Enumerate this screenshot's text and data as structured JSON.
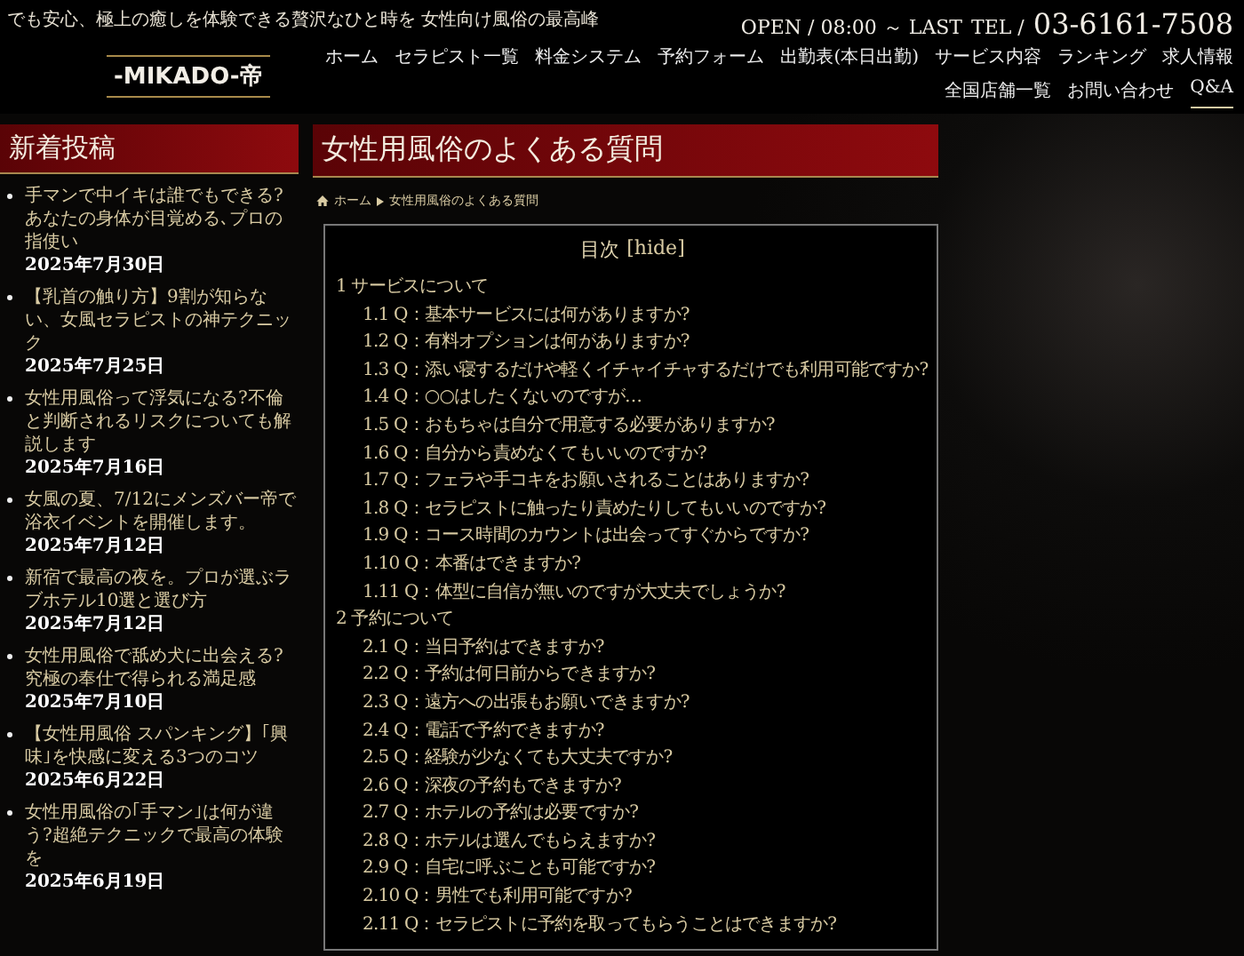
{
  "header": {
    "tagline": "でも安心、極上の癒しを体験できる贅沢なひと時を 女性向け風俗の最高峰",
    "logo": "-MIKADO-帝",
    "hours": "OPEN / 08:00 ～ LAST",
    "tel_label": "TEL /",
    "tel": "03-6161-7508"
  },
  "nav": [
    {
      "label": "ホーム",
      "selected": false
    },
    {
      "label": "セラピスト一覧",
      "selected": false
    },
    {
      "label": "料金システム",
      "selected": false
    },
    {
      "label": "予約フォーム",
      "selected": false
    },
    {
      "label": "出勤表(本日出勤)",
      "selected": false
    },
    {
      "label": "サービス内容",
      "selected": false
    },
    {
      "label": "ランキング",
      "selected": false
    },
    {
      "label": "求人情報",
      "selected": false
    },
    {
      "label": "全国店舗一覧",
      "selected": false
    },
    {
      "label": "お問い合わせ",
      "selected": false
    },
    {
      "label": "Q&A",
      "selected": true
    }
  ],
  "sidebar": {
    "title": "新着投稿",
    "posts": [
      {
        "title": "手マンで中イキは誰でもできる?あなたの身体が目覚める､プロの指使い",
        "date": "2025年7月30日"
      },
      {
        "title": "【乳首の触り方】9割が知らない、女風セラピストの神テクニック",
        "date": "2025年7月25日"
      },
      {
        "title": "女性用風俗って浮気になる?不倫と判断されるリスクについても解説します",
        "date": "2025年7月16日"
      },
      {
        "title": "女風の夏、7/12にメンズバー帝で浴衣イベントを開催します。",
        "date": "2025年7月12日"
      },
      {
        "title": "新宿で最高の夜を。プロが選ぶラブホテル10選と選び方",
        "date": "2025年7月12日"
      },
      {
        "title": "女性用風俗で舐め犬に出会える?究極の奉仕で得られる満足感",
        "date": "2025年7月10日"
      },
      {
        "title": "【女性用風俗 スパンキング】｢興味｣を快感に変える3つのコツ",
        "date": "2025年6月22日"
      },
      {
        "title": "女性用風俗の｢手マン｣は何が違う?超絶テクニックで最高の体験を",
        "date": "2025年6月19日"
      }
    ]
  },
  "page": {
    "title": "女性用風俗のよくある質問",
    "breadcrumb": [
      {
        "label": "ホーム"
      },
      {
        "label": "女性用風俗のよくある質問"
      }
    ]
  },
  "toc": {
    "title": "目次",
    "toggle": "[hide]",
    "expanded": true,
    "items": [
      {
        "label": "1 サービスについて",
        "children": [
          {
            "label": "1.1 Q：基本サービスには何がありますか?"
          },
          {
            "label": "1.2 Q：有料オプションは何がありますか?"
          },
          {
            "label": "1.3 Q：添い寝するだけや軽くイチャイチャするだけでも利用可能ですか?"
          },
          {
            "label": "1.4 Q：○○はしたくないのですが…"
          },
          {
            "label": "1.5 Q：おもちゃは自分で用意する必要がありますか?"
          },
          {
            "label": "1.6 Q：自分から責めなくてもいいのですか?"
          },
          {
            "label": "1.7 Q：フェラや手コキをお願いされることはありますか?"
          },
          {
            "label": "1.8 Q：セラピストに触ったり責めたりしてもいいのですか?"
          },
          {
            "label": "1.9 Q：コース時間のカウントは出会ってすぐからですか?"
          },
          {
            "label": "1.10 Q：本番はできますか?"
          },
          {
            "label": "1.11 Q：体型に自信が無いのですが大丈夫でしょうか?"
          }
        ]
      },
      {
        "label": "2 予約について",
        "children": [
          {
            "label": "2.1 Q：当日予約はできますか?"
          },
          {
            "label": "2.2 Q：予約は何日前からできますか?"
          },
          {
            "label": "2.3 Q：遠方への出張もお願いできますか?"
          },
          {
            "label": "2.4 Q：電話で予約できますか?"
          },
          {
            "label": "2.5 Q：経験が少なくても大丈夫ですか?"
          },
          {
            "label": "2.6 Q：深夜の予約もできますか?"
          },
          {
            "label": "2.7 Q：ホテルの予約は必要ですか?"
          },
          {
            "label": "2.8 Q：ホテルは選んでもらえますか?"
          },
          {
            "label": "2.9 Q：自宅に呼ぶことも可能ですか?"
          },
          {
            "label": "2.10 Q：男性でも利用可能ですか?"
          },
          {
            "label": "2.11 Q：セラピストに予約を取ってもらうことはできますか?"
          }
        ]
      }
    ]
  }
}
